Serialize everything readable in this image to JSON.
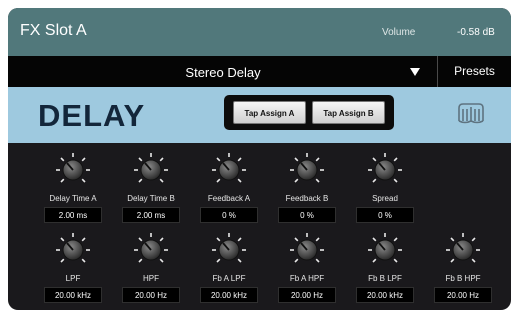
{
  "header": {
    "title": "FX Slot A",
    "volume_label": "Volume",
    "volume_value": "-0.58 dB"
  },
  "preset": {
    "name": "Stereo Delay",
    "presets_label": "Presets"
  },
  "effect": {
    "title": "DELAY",
    "tap_a": "Tap Assign A",
    "tap_b": "Tap Assign B"
  },
  "colors": {
    "header": "#51787b",
    "title_band": "#9ec9df",
    "panel": "#1a191c"
  },
  "knobs": [
    {
      "label": "Delay Time A",
      "value": "2.00 ms"
    },
    {
      "label": "Delay Time B",
      "value": "2.00 ms"
    },
    {
      "label": "Feedback A",
      "value": "0 %"
    },
    {
      "label": "Feedback B",
      "value": "0 %"
    },
    {
      "label": "Spread",
      "value": "0 %"
    },
    {
      "label": "LPF",
      "value": "20.00 kHz"
    },
    {
      "label": "HPF",
      "value": "20.00 Hz"
    },
    {
      "label": "Fb A LPF",
      "value": "20.00 kHz"
    },
    {
      "label": "Fb A HPF",
      "value": "20.00 Hz"
    },
    {
      "label": "Fb B LPF",
      "value": "20.00 kHz"
    },
    {
      "label": "Fb B HPF",
      "value": "20.00 Hz"
    }
  ]
}
